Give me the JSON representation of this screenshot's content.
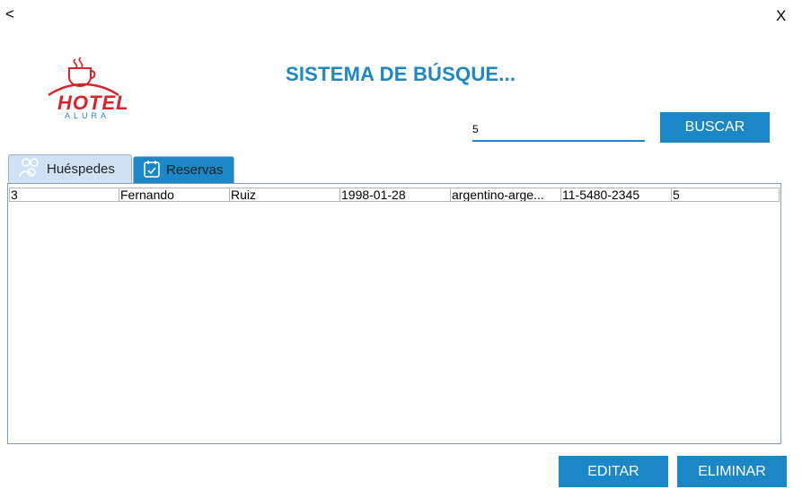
{
  "nav": {
    "back_label": "<",
    "close_label": "X"
  },
  "logo": {
    "text": "HOTEL",
    "subtext": "ALURA"
  },
  "title": "SISTEMA DE BÚSQUE...",
  "search": {
    "value": "5",
    "button_label": "BUSCAR"
  },
  "tabs": [
    {
      "label": "Huéspedes",
      "icon": "guests-icon",
      "selected": true
    },
    {
      "label": "Reservas",
      "icon": "calendar-check-icon",
      "selected": false
    }
  ],
  "table": {
    "rows": [
      [
        "3",
        "Fernando",
        "Ruiz",
        "1998-01-28",
        "argentino-arge...",
        "11-5480-2345",
        "5"
      ]
    ]
  },
  "actions": {
    "edit_label": "EDITAR",
    "delete_label": "ELIMINAR"
  },
  "colors": {
    "accent": "#1b87c6",
    "logo_red": "#d8232a",
    "tab_selected": "#cfe2f5"
  }
}
